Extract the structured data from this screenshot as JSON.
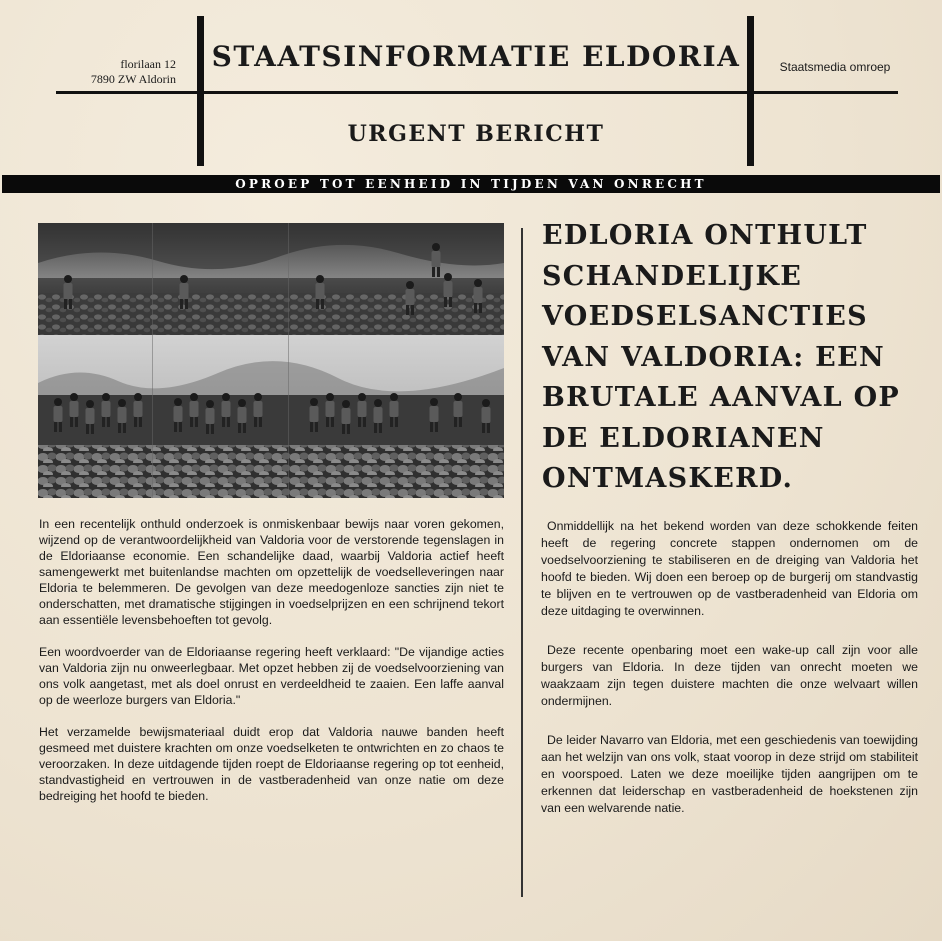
{
  "header": {
    "address_line1": "florilaan 12",
    "address_line2": "7890 ZW Aldorin",
    "masthead": "STAATSINFORMATIE ELDORIA",
    "broadcaster": "Staatsmedia omroep",
    "urgent_label": "URGENT BERICHT"
  },
  "banner": "OPROEP TOT EENHEID IN TIJDEN VAN ONRECHT",
  "headline": "EDLORIA ONTHULT SCHANDELIJKE VOEDSELSANCTIES VAN VALDORIA: EEN BRUTALE AANVAL OP DE ELDORIANEN ONTMASKERD.",
  "left_column": [
    "In een recentelijk onthuld onderzoek is onmiskenbaar bewijs naar voren gekomen, wijzend op de verantwoordelijkheid van Valdoria voor de verstorende tegenslagen in de Eldoriaanse economie. Een schandelijke daad, waarbij Valdoria actief heeft samengewerkt met buitenlandse machten om opzettelijk de voedselleveringen naar Eldoria te belemmeren. De gevolgen van deze meedogenloze sancties zijn niet te onderschatten, met dramatische stijgingen in voedselprijzen en een schrijnend tekort aan essentiële levensbehoeften tot gevolg.",
    "Een woordvoerder van de Eldoriaanse regering heeft verklaard: \"De vijandige acties van Valdoria zijn nu onweerlegbaar. Met opzet hebben zij de voedselvoorziening van ons volk aangetast, met als doel onrust en verdeeldheid te zaaien. Een laffe aanval op de weerloze burgers van Eldoria.\"",
    "Het verzamelde bewijsmateriaal duidt erop dat Valdoria nauwe banden heeft gesmeed met duistere krachten om onze voedselketen te ontwrichten en zo chaos te veroorzaken. In deze uitdagende tijden roept de Eldoriaanse regering op tot eenheid, standvastigheid en vertrouwen in de vastberadenheid van onze natie om deze bedreiging het hoofd te bieden."
  ],
  "right_column": [
    "Onmiddellijk na het bekend worden van deze schokkende feiten heeft de regering concrete stappen ondernomen om de voedselvoorziening te stabiliseren en de dreiging van Valdoria het hoofd te bieden. Wij doen een beroep op de burgerij om standvastig te blijven en te vertrouwen op de vastberadenheid van Eldoria om deze uitdaging te overwinnen.",
    "Deze recente openbaring moet een wake-up call zijn voor alle burgers van Eldoria. In deze tijden van onrecht moeten we waakzaam zijn tegen duistere machten die onze welvaart willen ondermijnen.",
    "De leider Navarro van Eldoria, met een geschiedenis van toewijding aan het welzijn van ons volk, staat voorop in deze strijd om stabiliteit en voorspoed. Laten we deze moeilijke tijden aangrijpen om te erkennen dat leiderschap en vastberadenheid de hoekstenen zijn van een welvarende natie."
  ]
}
